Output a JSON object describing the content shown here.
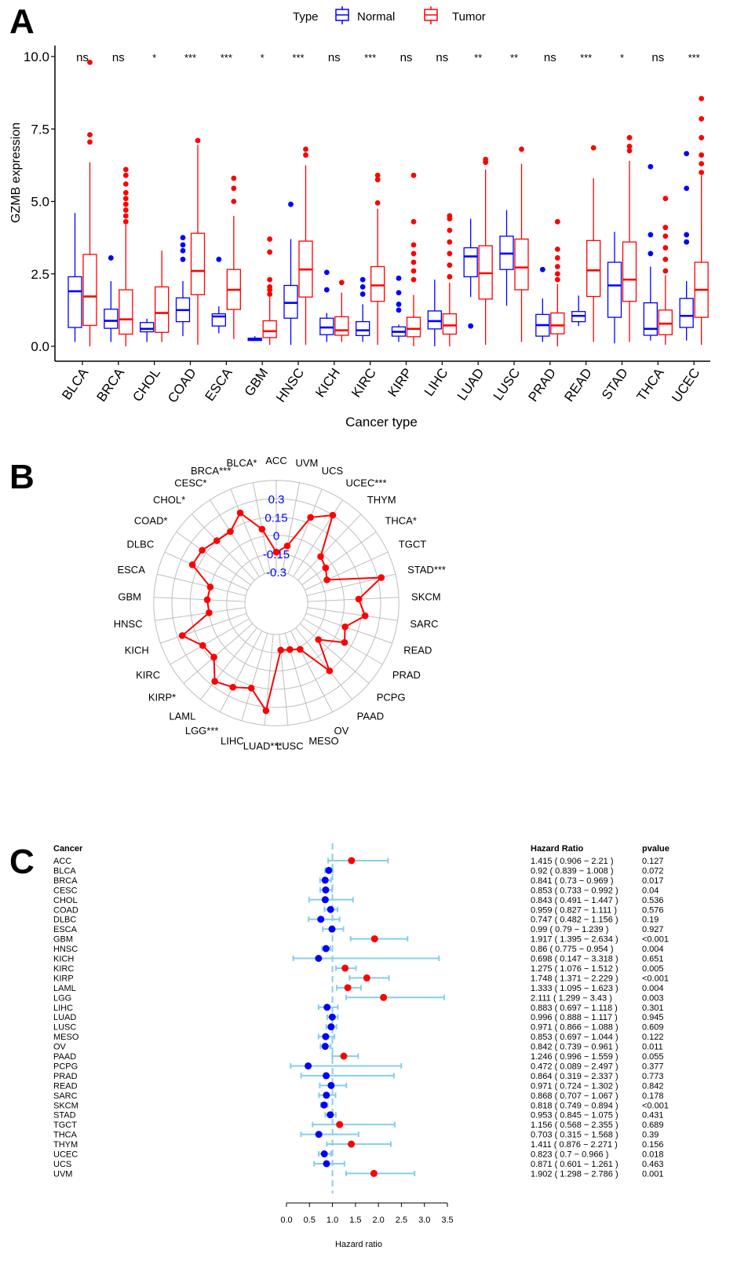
{
  "panels": {
    "a": "A",
    "b": "B",
    "c": "C"
  },
  "chart_data": [
    {
      "type": "box",
      "title": "",
      "xlabel": "Cancer type",
      "ylabel": "GZMB expression",
      "ylim": [
        -0.3,
        10.2
      ],
      "yticks": [
        "0.0",
        "2.5",
        "5.0",
        "7.5",
        "10.0"
      ],
      "legend": {
        "title": "Type",
        "position": "top",
        "entries": [
          {
            "name": "Normal",
            "color": "#0000FF"
          },
          {
            "name": "Tumor",
            "color": "#FF0000"
          }
        ]
      },
      "categories": [
        "BLCA",
        "BRCA",
        "CHOL",
        "COAD",
        "ESCA",
        "GBM",
        "HNSC",
        "KICH",
        "KIRC",
        "KIRP",
        "LIHC",
        "LUAD",
        "LUSC",
        "PRAD",
        "READ",
        "STAD",
        "THCA",
        "UCEC"
      ],
      "significance": [
        "ns",
        "ns",
        "*",
        "***",
        "***",
        "*",
        "***",
        "ns",
        "***",
        "ns",
        "ns",
        "**",
        "**",
        "ns",
        "***",
        "*",
        "ns",
        "***"
      ],
      "series": [
        {
          "name": "Normal",
          "color": "#0000FF",
          "boxes": [
            {
              "min": 0.15,
              "q1": 0.65,
              "median": 1.9,
              "q3": 2.4,
              "max": 4.6,
              "outliers": []
            },
            {
              "min": 0.15,
              "q1": 0.62,
              "median": 0.88,
              "q3": 1.28,
              "max": 2.25,
              "outliers": [
                3.05
              ]
            },
            {
              "min": 0.15,
              "q1": 0.5,
              "median": 0.6,
              "q3": 0.82,
              "max": 0.95,
              "outliers": []
            },
            {
              "min": 0.35,
              "q1": 0.85,
              "median": 1.25,
              "q3": 1.67,
              "max": 2.25,
              "outliers": [
                3.0,
                3.3,
                3.5,
                3.75
              ]
            },
            {
              "min": 0.45,
              "q1": 0.7,
              "median": 1.03,
              "q3": 1.12,
              "max": 1.38,
              "outliers": [
                3.0
              ]
            },
            {
              "min": 0.2,
              "q1": 0.2,
              "median": 0.25,
              "q3": 0.28,
              "max": 0.35,
              "outliers": []
            },
            {
              "min": 0.05,
              "q1": 0.97,
              "median": 1.5,
              "q3": 2.1,
              "max": 3.7,
              "outliers": [
                4.9
              ]
            },
            {
              "min": 0.15,
              "q1": 0.4,
              "median": 0.65,
              "q3": 0.97,
              "max": 1.15,
              "outliers": [
                1.95,
                2.55
              ]
            },
            {
              "min": 0.15,
              "q1": 0.37,
              "median": 0.55,
              "q3": 0.85,
              "max": 1.45,
              "outliers": [
                1.8,
                2.05,
                2.3
              ]
            },
            {
              "min": 0.15,
              "q1": 0.35,
              "median": 0.5,
              "q3": 0.67,
              "max": 0.75,
              "outliers": [
                1.25,
                1.45,
                1.85,
                2.35
              ]
            },
            {
              "min": 0.0,
              "q1": 0.6,
              "median": 0.87,
              "q3": 1.22,
              "max": 2.3,
              "outliers": []
            },
            {
              "min": 1.7,
              "q1": 2.4,
              "median": 3.1,
              "q3": 3.4,
              "max": 4.4,
              "outliers": [
                0.7
              ]
            },
            {
              "min": 1.4,
              "q1": 2.65,
              "median": 3.2,
              "q3": 3.8,
              "max": 4.7,
              "outliers": []
            },
            {
              "min": 0.15,
              "q1": 0.35,
              "median": 0.73,
              "q3": 1.1,
              "max": 1.65,
              "outliers": [
                2.65
              ]
            },
            {
              "min": 0.7,
              "q1": 0.85,
              "median": 1.05,
              "q3": 1.2,
              "max": 1.75,
              "outliers": []
            },
            {
              "min": 0.1,
              "q1": 1.0,
              "median": 2.1,
              "q3": 2.9,
              "max": 3.95,
              "outliers": []
            },
            {
              "min": 0.2,
              "q1": 0.38,
              "median": 0.6,
              "q3": 1.5,
              "max": 2.75,
              "outliers": [
                3.2,
                3.85,
                6.2
              ]
            },
            {
              "min": 0.2,
              "q1": 0.65,
              "median": 1.05,
              "q3": 1.65,
              "max": 2.25,
              "outliers": [
                3.6,
                3.85,
                5.45,
                6.65
              ]
            }
          ]
        },
        {
          "name": "Tumor",
          "color": "#FF0000",
          "boxes": [
            {
              "min": 0.0,
              "q1": 0.72,
              "median": 1.72,
              "q3": 3.17,
              "max": 6.35,
              "outliers": [
                7.05,
                7.3,
                9.8
              ]
            },
            {
              "min": 0.0,
              "q1": 0.42,
              "median": 0.93,
              "q3": 1.95,
              "max": 4.2,
              "outliers": [
                4.3,
                4.5,
                4.7,
                4.9,
                5.1,
                5.3,
                5.6,
                5.9,
                6.1
              ]
            },
            {
              "min": 0.15,
              "q1": 0.48,
              "median": 1.15,
              "q3": 2.05,
              "max": 3.3,
              "outliers": []
            },
            {
              "min": 0.05,
              "q1": 1.78,
              "median": 2.6,
              "q3": 3.9,
              "max": 6.95,
              "outliers": [
                7.1
              ]
            },
            {
              "min": 0.25,
              "q1": 1.27,
              "median": 1.95,
              "q3": 2.65,
              "max": 4.5,
              "outliers": [
                5.0,
                5.45,
                5.8
              ]
            },
            {
              "min": 0.05,
              "q1": 0.3,
              "median": 0.52,
              "q3": 0.88,
              "max": 1.7,
              "outliers": [
                1.8,
                1.95,
                2.05,
                2.3,
                3.25,
                3.7
              ]
            },
            {
              "min": 0.05,
              "q1": 1.7,
              "median": 2.65,
              "q3": 3.63,
              "max": 6.25,
              "outliers": [
                6.6,
                6.8
              ]
            },
            {
              "min": 0.15,
              "q1": 0.38,
              "median": 0.55,
              "q3": 1.02,
              "max": 1.85,
              "outliers": [
                2.2
              ]
            },
            {
              "min": 0.05,
              "q1": 1.55,
              "median": 2.1,
              "q3": 2.75,
              "max": 4.75,
              "outliers": [
                4.95,
                5.75,
                5.9
              ]
            },
            {
              "min": 0.0,
              "q1": 0.33,
              "median": 0.6,
              "q3": 1.0,
              "max": 1.77,
              "outliers": [
                2.3,
                2.6,
                2.9,
                3.2,
                3.5,
                4.3,
                5.9
              ]
            },
            {
              "min": 0.0,
              "q1": 0.42,
              "median": 0.72,
              "q3": 1.12,
              "max": 2.2,
              "outliers": [
                2.4,
                2.8,
                3.2,
                3.6,
                4.0,
                4.4,
                4.5
              ]
            },
            {
              "min": 0.05,
              "q1": 1.63,
              "median": 2.52,
              "q3": 3.47,
              "max": 6.1,
              "outliers": [
                6.35,
                6.45
              ]
            },
            {
              "min": 0.15,
              "q1": 1.95,
              "median": 2.72,
              "q3": 3.7,
              "max": 6.3,
              "outliers": [
                6.8
              ]
            },
            {
              "min": 0.0,
              "q1": 0.43,
              "median": 0.72,
              "q3": 1.15,
              "max": 2.15,
              "outliers": [
                2.3,
                2.5,
                2.75,
                3.05,
                3.35,
                4.3
              ]
            },
            {
              "min": 0.15,
              "q1": 1.72,
              "median": 2.62,
              "q3": 3.65,
              "max": 5.8,
              "outliers": [
                6.85
              ]
            },
            {
              "min": 0.15,
              "q1": 1.55,
              "median": 2.3,
              "q3": 3.6,
              "max": 6.4,
              "outliers": [
                6.75,
                6.9,
                7.2
              ]
            },
            {
              "min": 0.05,
              "q1": 0.4,
              "median": 0.78,
              "q3": 1.25,
              "max": 2.45,
              "outliers": [
                2.6,
                3.0,
                3.4,
                3.8,
                4.1,
                5.1
              ]
            },
            {
              "min": 0.05,
              "q1": 1.0,
              "median": 1.95,
              "q3": 2.9,
              "max": 5.9,
              "outliers": [
                6.0,
                6.3,
                6.6,
                7.2,
                7.85,
                8.55
              ]
            }
          ]
        }
      ]
    },
    {
      "type": "radar",
      "title": "",
      "rlim": [
        -0.3,
        0.45
      ],
      "rticks": [
        "-0.3",
        "-0.15",
        "0",
        "0.15",
        "0.3"
      ],
      "line_color": "#FF0000",
      "tick_color": "#0000FF",
      "categories": [
        "ACC",
        "UVM",
        "UCS",
        "UCEC***",
        "THYM",
        "THCA*",
        "TGCT",
        "STAD***",
        "SKCM",
        "SARC",
        "READ",
        "PRAD",
        "PCPG",
        "PAAD",
        "OV",
        "MESO",
        "LUSC",
        "LUAD***",
        "LIHC",
        "LGG***",
        "LAML",
        "KIRP*",
        "KIRC",
        "KICH",
        "HNSC",
        "GBM",
        "ESCA",
        "DLBC",
        "COAD*",
        "CHOL*",
        "CESC*",
        "BRCA***",
        "BLCA*"
      ],
      "values": [
        -0.14,
        -0.08,
        0.2,
        0.3,
        -0.03,
        -0.06,
        -0.1,
        0.33,
        0.12,
        0.18,
        0.04,
        0.09,
        -0.1,
        0.15,
        -0.13,
        -0.16,
        -0.17,
        0.33,
        0.17,
        0.22,
        0.26,
        0.12,
        0.14,
        0.26,
        0.0,
        0.01,
        0.0,
        0.2,
        0.19,
        0.15,
        0.14,
        0.24,
        0.06
      ]
    },
    {
      "type": "forest",
      "xlabel": "Hazard ratio",
      "xlim": [
        0.0,
        3.5
      ],
      "xticks": [
        "0.0",
        "0.5",
        "1.0",
        "1.5",
        "2.0",
        "2.5",
        "3.0",
        "3.5"
      ],
      "reference_line": 1.0,
      "headers": {
        "cancer": "Cancer",
        "hr": "Hazard Ratio",
        "p": "pvalue"
      },
      "colors": {
        "risk": "#FF0000",
        "protective": "#0000FF",
        "ci": "#87CEEB"
      },
      "rows": [
        {
          "cancer": "ACC",
          "hr": 1.415,
          "lo": 0.906,
          "hi": 2.21,
          "label": "1.415 ( 0.906 − 2.21 )",
          "p": "0.127"
        },
        {
          "cancer": "BLCA",
          "hr": 0.92,
          "lo": 0.839,
          "hi": 1.008,
          "label": "0.92 ( 0.839 − 1.008 )",
          "p": "0.072"
        },
        {
          "cancer": "BRCA",
          "hr": 0.841,
          "lo": 0.73,
          "hi": 0.969,
          "label": "0.841 ( 0.73 − 0.969 )",
          "p": "0.017"
        },
        {
          "cancer": "CESC",
          "hr": 0.853,
          "lo": 0.733,
          "hi": 0.992,
          "label": "0.853 ( 0.733 − 0.992 )",
          "p": "0.04"
        },
        {
          "cancer": "CHOL",
          "hr": 0.843,
          "lo": 0.491,
          "hi": 1.447,
          "label": "0.843 ( 0.491 − 1.447 )",
          "p": "0.536"
        },
        {
          "cancer": "COAD",
          "hr": 0.959,
          "lo": 0.827,
          "hi": 1.111,
          "label": "0.959 ( 0.827 − 1.111 )",
          "p": "0.576"
        },
        {
          "cancer": "DLBC",
          "hr": 0.747,
          "lo": 0.482,
          "hi": 1.156,
          "label": "0.747 ( 0.482 − 1.156 )",
          "p": "0.19"
        },
        {
          "cancer": "ESCA",
          "hr": 0.99,
          "lo": 0.79,
          "hi": 1.239,
          "label": "0.99 ( 0.79 − 1.239 )",
          "p": "0.927"
        },
        {
          "cancer": "GBM",
          "hr": 1.917,
          "lo": 1.395,
          "hi": 2.634,
          "label": "1.917 ( 1.395 − 2.634 )",
          "p": "<0.001"
        },
        {
          "cancer": "HNSC",
          "hr": 0.86,
          "lo": 0.775,
          "hi": 0.954,
          "label": "0.86 ( 0.775 − 0.954 )",
          "p": "0.004"
        },
        {
          "cancer": "KICH",
          "hr": 0.698,
          "lo": 0.147,
          "hi": 3.318,
          "label": "0.698 ( 0.147 − 3.318 )",
          "p": "0.651"
        },
        {
          "cancer": "KIRC",
          "hr": 1.275,
          "lo": 1.076,
          "hi": 1.512,
          "label": "1.275 ( 1.076 − 1.512 )",
          "p": "0.005"
        },
        {
          "cancer": "KIRP",
          "hr": 1.748,
          "lo": 1.371,
          "hi": 2.229,
          "label": "1.748 ( 1.371 − 2.229 )",
          "p": "<0.001"
        },
        {
          "cancer": "LAML",
          "hr": 1.333,
          "lo": 1.095,
          "hi": 1.623,
          "label": "1.333 ( 1.095 − 1.623 )",
          "p": "0.004"
        },
        {
          "cancer": "LGG",
          "hr": 2.111,
          "lo": 1.299,
          "hi": 3.43,
          "label": "2.111 ( 1.299 − 3.43 )",
          "p": "0.003"
        },
        {
          "cancer": "LIHC",
          "hr": 0.883,
          "lo": 0.697,
          "hi": 1.118,
          "label": "0.883 ( 0.697 − 1.118 )",
          "p": "0.301"
        },
        {
          "cancer": "LUAD",
          "hr": 0.996,
          "lo": 0.888,
          "hi": 1.117,
          "label": "0.996 ( 0.888 − 1.117 )",
          "p": "0.945"
        },
        {
          "cancer": "LUSC",
          "hr": 0.971,
          "lo": 0.866,
          "hi": 1.088,
          "label": "0.971 ( 0.866 − 1.088 )",
          "p": "0.609"
        },
        {
          "cancer": "MESO",
          "hr": 0.853,
          "lo": 0.697,
          "hi": 1.044,
          "label": "0.853 ( 0.697 − 1.044 )",
          "p": "0.122"
        },
        {
          "cancer": "OV",
          "hr": 0.842,
          "lo": 0.739,
          "hi": 0.961,
          "label": "0.842 ( 0.739 − 0.961 )",
          "p": "0.011"
        },
        {
          "cancer": "PAAD",
          "hr": 1.246,
          "lo": 0.996,
          "hi": 1.559,
          "label": "1.246 ( 0.996 − 1.559 )",
          "p": "0.055"
        },
        {
          "cancer": "PCPG",
          "hr": 0.472,
          "lo": 0.089,
          "hi": 2.497,
          "label": "0.472 ( 0.089 − 2.497 )",
          "p": "0.377"
        },
        {
          "cancer": "PRAD",
          "hr": 0.864,
          "lo": 0.319,
          "hi": 2.337,
          "label": "0.864 ( 0.319 − 2.337 )",
          "p": "0.773"
        },
        {
          "cancer": "READ",
          "hr": 0.971,
          "lo": 0.724,
          "hi": 1.302,
          "label": "0.971 ( 0.724 − 1.302 )",
          "p": "0.842"
        },
        {
          "cancer": "SARC",
          "hr": 0.868,
          "lo": 0.707,
          "hi": 1.067,
          "label": "0.868 ( 0.707 − 1.067 )",
          "p": "0.178"
        },
        {
          "cancer": "SKCM",
          "hr": 0.818,
          "lo": 0.749,
          "hi": 0.894,
          "label": "0.818 ( 0.749 − 0.894 )",
          "p": "<0.001"
        },
        {
          "cancer": "STAD",
          "hr": 0.953,
          "lo": 0.845,
          "hi": 1.075,
          "label": "0.953 ( 0.845 − 1.075 )",
          "p": "0.431"
        },
        {
          "cancer": "TGCT",
          "hr": 1.156,
          "lo": 0.568,
          "hi": 2.355,
          "label": "1.156 ( 0.568 − 2.355 )",
          "p": "0.689"
        },
        {
          "cancer": "THCA",
          "hr": 0.703,
          "lo": 0.315,
          "hi": 1.568,
          "label": "0.703 ( 0.315 − 1.568 )",
          "p": "0.39"
        },
        {
          "cancer": "THYM",
          "hr": 1.411,
          "lo": 0.876,
          "hi": 2.271,
          "label": "1.411 ( 0.876 − 2.271 )",
          "p": "0.156"
        },
        {
          "cancer": "UCEC",
          "hr": 0.823,
          "lo": 0.7,
          "hi": 0.966,
          "label": "0.823 ( 0.7 − 0.966 )",
          "p": "0.018"
        },
        {
          "cancer": "UCS",
          "hr": 0.871,
          "lo": 0.601,
          "hi": 1.261,
          "label": "0.871 ( 0.601 − 1.261 )",
          "p": "0.463"
        },
        {
          "cancer": "UVM",
          "hr": 1.902,
          "lo": 1.298,
          "hi": 2.786,
          "label": "1.902 ( 1.298 − 2.786 )",
          "p": "0.001"
        }
      ]
    }
  ]
}
